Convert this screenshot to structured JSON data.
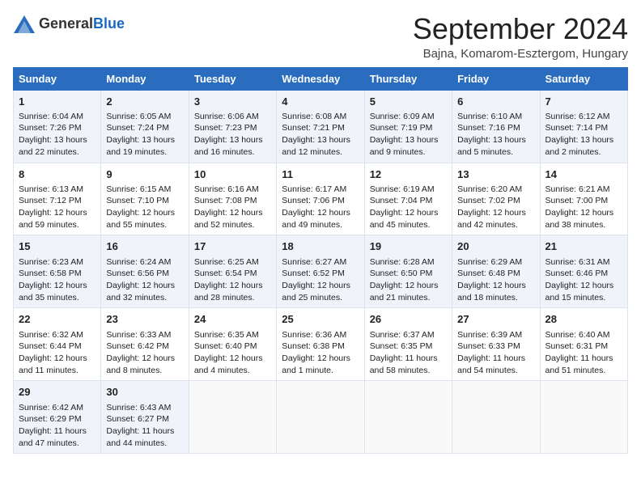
{
  "logo": {
    "general": "General",
    "blue": "Blue"
  },
  "header": {
    "month": "September 2024",
    "location": "Bajna, Komarom-Esztergom, Hungary"
  },
  "days_of_week": [
    "Sunday",
    "Monday",
    "Tuesday",
    "Wednesday",
    "Thursday",
    "Friday",
    "Saturday"
  ],
  "weeks": [
    [
      {
        "day": "1",
        "lines": [
          "Sunrise: 6:04 AM",
          "Sunset: 7:26 PM",
          "Daylight: 13 hours",
          "and 22 minutes."
        ]
      },
      {
        "day": "2",
        "lines": [
          "Sunrise: 6:05 AM",
          "Sunset: 7:24 PM",
          "Daylight: 13 hours",
          "and 19 minutes."
        ]
      },
      {
        "day": "3",
        "lines": [
          "Sunrise: 6:06 AM",
          "Sunset: 7:23 PM",
          "Daylight: 13 hours",
          "and 16 minutes."
        ]
      },
      {
        "day": "4",
        "lines": [
          "Sunrise: 6:08 AM",
          "Sunset: 7:21 PM",
          "Daylight: 13 hours",
          "and 12 minutes."
        ]
      },
      {
        "day": "5",
        "lines": [
          "Sunrise: 6:09 AM",
          "Sunset: 7:19 PM",
          "Daylight: 13 hours",
          "and 9 minutes."
        ]
      },
      {
        "day": "6",
        "lines": [
          "Sunrise: 6:10 AM",
          "Sunset: 7:16 PM",
          "Daylight: 13 hours",
          "and 5 minutes."
        ]
      },
      {
        "day": "7",
        "lines": [
          "Sunrise: 6:12 AM",
          "Sunset: 7:14 PM",
          "Daylight: 13 hours",
          "and 2 minutes."
        ]
      }
    ],
    [
      {
        "day": "8",
        "lines": [
          "Sunrise: 6:13 AM",
          "Sunset: 7:12 PM",
          "Daylight: 12 hours",
          "and 59 minutes."
        ]
      },
      {
        "day": "9",
        "lines": [
          "Sunrise: 6:15 AM",
          "Sunset: 7:10 PM",
          "Daylight: 12 hours",
          "and 55 minutes."
        ]
      },
      {
        "day": "10",
        "lines": [
          "Sunrise: 6:16 AM",
          "Sunset: 7:08 PM",
          "Daylight: 12 hours",
          "and 52 minutes."
        ]
      },
      {
        "day": "11",
        "lines": [
          "Sunrise: 6:17 AM",
          "Sunset: 7:06 PM",
          "Daylight: 12 hours",
          "and 49 minutes."
        ]
      },
      {
        "day": "12",
        "lines": [
          "Sunrise: 6:19 AM",
          "Sunset: 7:04 PM",
          "Daylight: 12 hours",
          "and 45 minutes."
        ]
      },
      {
        "day": "13",
        "lines": [
          "Sunrise: 6:20 AM",
          "Sunset: 7:02 PM",
          "Daylight: 12 hours",
          "and 42 minutes."
        ]
      },
      {
        "day": "14",
        "lines": [
          "Sunrise: 6:21 AM",
          "Sunset: 7:00 PM",
          "Daylight: 12 hours",
          "and 38 minutes."
        ]
      }
    ],
    [
      {
        "day": "15",
        "lines": [
          "Sunrise: 6:23 AM",
          "Sunset: 6:58 PM",
          "Daylight: 12 hours",
          "and 35 minutes."
        ]
      },
      {
        "day": "16",
        "lines": [
          "Sunrise: 6:24 AM",
          "Sunset: 6:56 PM",
          "Daylight: 12 hours",
          "and 32 minutes."
        ]
      },
      {
        "day": "17",
        "lines": [
          "Sunrise: 6:25 AM",
          "Sunset: 6:54 PM",
          "Daylight: 12 hours",
          "and 28 minutes."
        ]
      },
      {
        "day": "18",
        "lines": [
          "Sunrise: 6:27 AM",
          "Sunset: 6:52 PM",
          "Daylight: 12 hours",
          "and 25 minutes."
        ]
      },
      {
        "day": "19",
        "lines": [
          "Sunrise: 6:28 AM",
          "Sunset: 6:50 PM",
          "Daylight: 12 hours",
          "and 21 minutes."
        ]
      },
      {
        "day": "20",
        "lines": [
          "Sunrise: 6:29 AM",
          "Sunset: 6:48 PM",
          "Daylight: 12 hours",
          "and 18 minutes."
        ]
      },
      {
        "day": "21",
        "lines": [
          "Sunrise: 6:31 AM",
          "Sunset: 6:46 PM",
          "Daylight: 12 hours",
          "and 15 minutes."
        ]
      }
    ],
    [
      {
        "day": "22",
        "lines": [
          "Sunrise: 6:32 AM",
          "Sunset: 6:44 PM",
          "Daylight: 12 hours",
          "and 11 minutes."
        ]
      },
      {
        "day": "23",
        "lines": [
          "Sunrise: 6:33 AM",
          "Sunset: 6:42 PM",
          "Daylight: 12 hours",
          "and 8 minutes."
        ]
      },
      {
        "day": "24",
        "lines": [
          "Sunrise: 6:35 AM",
          "Sunset: 6:40 PM",
          "Daylight: 12 hours",
          "and 4 minutes."
        ]
      },
      {
        "day": "25",
        "lines": [
          "Sunrise: 6:36 AM",
          "Sunset: 6:38 PM",
          "Daylight: 12 hours",
          "and 1 minute."
        ]
      },
      {
        "day": "26",
        "lines": [
          "Sunrise: 6:37 AM",
          "Sunset: 6:35 PM",
          "Daylight: 11 hours",
          "and 58 minutes."
        ]
      },
      {
        "day": "27",
        "lines": [
          "Sunrise: 6:39 AM",
          "Sunset: 6:33 PM",
          "Daylight: 11 hours",
          "and 54 minutes."
        ]
      },
      {
        "day": "28",
        "lines": [
          "Sunrise: 6:40 AM",
          "Sunset: 6:31 PM",
          "Daylight: 11 hours",
          "and 51 minutes."
        ]
      }
    ],
    [
      {
        "day": "29",
        "lines": [
          "Sunrise: 6:42 AM",
          "Sunset: 6:29 PM",
          "Daylight: 11 hours",
          "and 47 minutes."
        ]
      },
      {
        "day": "30",
        "lines": [
          "Sunrise: 6:43 AM",
          "Sunset: 6:27 PM",
          "Daylight: 11 hours",
          "and 44 minutes."
        ]
      },
      null,
      null,
      null,
      null,
      null
    ]
  ]
}
